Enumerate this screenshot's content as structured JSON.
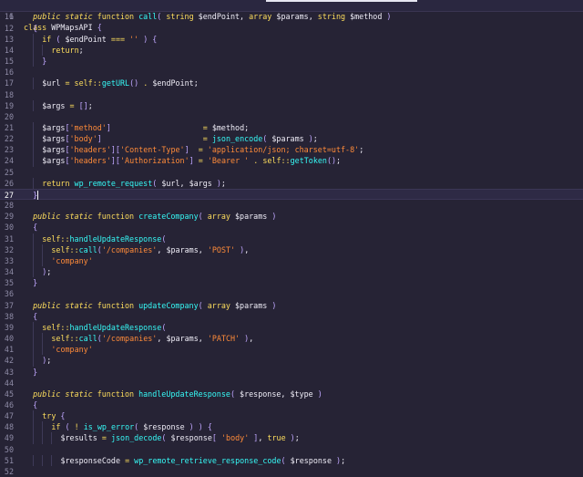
{
  "editor": {
    "sticky_line": {
      "number": "6",
      "tokens": [
        {
          "t": "class ",
          "c": "kw"
        },
        {
          "t": "WPMapsAPI",
          "c": "plain"
        },
        {
          "t": " {",
          "c": "punc"
        }
      ]
    },
    "lines": [
      {
        "n": "11",
        "indent": 2,
        "tokens": [
          {
            "t": "public static ",
            "c": "mod"
          },
          {
            "t": "function ",
            "c": "kw"
          },
          {
            "t": "call",
            "c": "fn"
          },
          {
            "t": "( ",
            "c": "punc"
          },
          {
            "t": "string ",
            "c": "type"
          },
          {
            "t": "$endPoint",
            "c": "var"
          },
          {
            "t": ", ",
            "c": "plain"
          },
          {
            "t": "array ",
            "c": "type"
          },
          {
            "t": "$params",
            "c": "var"
          },
          {
            "t": ", ",
            "c": "plain"
          },
          {
            "t": "string ",
            "c": "type"
          },
          {
            "t": "$method",
            "c": "var"
          },
          {
            "t": " )",
            "c": "punc"
          }
        ]
      },
      {
        "n": "12",
        "indent": 2,
        "tokens": [
          {
            "t": "{",
            "c": "punc"
          }
        ]
      },
      {
        "n": "13",
        "indent": 4,
        "tokens": [
          {
            "t": "if ",
            "c": "kw"
          },
          {
            "t": "( ",
            "c": "punc"
          },
          {
            "t": "$endPoint",
            "c": "var"
          },
          {
            "t": " === ",
            "c": "op"
          },
          {
            "t": "''",
            "c": "str"
          },
          {
            "t": " ) {",
            "c": "punc"
          }
        ]
      },
      {
        "n": "14",
        "indent": 6,
        "tokens": [
          {
            "t": "return",
            "c": "kw"
          },
          {
            "t": ";",
            "c": "plain"
          }
        ]
      },
      {
        "n": "15",
        "indent": 4,
        "tokens": [
          {
            "t": "}",
            "c": "punc"
          }
        ]
      },
      {
        "n": "16",
        "indent": 0,
        "tokens": []
      },
      {
        "n": "17",
        "indent": 4,
        "tokens": [
          {
            "t": "$url",
            "c": "var"
          },
          {
            "t": " = ",
            "c": "op"
          },
          {
            "t": "self",
            "c": "kw"
          },
          {
            "t": "::",
            "c": "op"
          },
          {
            "t": "getURL",
            "c": "fn"
          },
          {
            "t": "()",
            "c": "punc"
          },
          {
            "t": " . ",
            "c": "op"
          },
          {
            "t": "$endPoint",
            "c": "var"
          },
          {
            "t": ";",
            "c": "plain"
          }
        ]
      },
      {
        "n": "18",
        "indent": 0,
        "tokens": []
      },
      {
        "n": "19",
        "indent": 4,
        "tokens": [
          {
            "t": "$args",
            "c": "var"
          },
          {
            "t": " = ",
            "c": "op"
          },
          {
            "t": "[]",
            "c": "punc"
          },
          {
            "t": ";",
            "c": "plain"
          }
        ]
      },
      {
        "n": "20",
        "indent": 0,
        "tokens": []
      },
      {
        "n": "21",
        "indent": 4,
        "tokens": [
          {
            "t": "$args",
            "c": "var"
          },
          {
            "t": "[",
            "c": "punc"
          },
          {
            "t": "'method'",
            "c": "str"
          },
          {
            "t": "]",
            "c": "punc"
          },
          {
            "t": "                    = ",
            "c": "op"
          },
          {
            "t": "$method",
            "c": "var"
          },
          {
            "t": ";",
            "c": "plain"
          }
        ]
      },
      {
        "n": "22",
        "indent": 4,
        "tokens": [
          {
            "t": "$args",
            "c": "var"
          },
          {
            "t": "[",
            "c": "punc"
          },
          {
            "t": "'body'",
            "c": "str"
          },
          {
            "t": "]",
            "c": "punc"
          },
          {
            "t": "                      = ",
            "c": "op"
          },
          {
            "t": "json_encode",
            "c": "fn"
          },
          {
            "t": "( ",
            "c": "punc"
          },
          {
            "t": "$params",
            "c": "var"
          },
          {
            "t": " )",
            "c": "punc"
          },
          {
            "t": ";",
            "c": "plain"
          }
        ]
      },
      {
        "n": "23",
        "indent": 4,
        "tokens": [
          {
            "t": "$args",
            "c": "var"
          },
          {
            "t": "[",
            "c": "punc"
          },
          {
            "t": "'headers'",
            "c": "str"
          },
          {
            "t": "][",
            "c": "punc"
          },
          {
            "t": "'Content-Type'",
            "c": "str"
          },
          {
            "t": "]",
            "c": "punc"
          },
          {
            "t": "  = ",
            "c": "op"
          },
          {
            "t": "'application/json; charset=utf-8'",
            "c": "str"
          },
          {
            "t": ";",
            "c": "plain"
          }
        ]
      },
      {
        "n": "24",
        "indent": 4,
        "tokens": [
          {
            "t": "$args",
            "c": "var"
          },
          {
            "t": "[",
            "c": "punc"
          },
          {
            "t": "'headers'",
            "c": "str"
          },
          {
            "t": "][",
            "c": "punc"
          },
          {
            "t": "'Authorization'",
            "c": "str"
          },
          {
            "t": "]",
            "c": "punc"
          },
          {
            "t": " = ",
            "c": "op"
          },
          {
            "t": "'Bearer '",
            "c": "str"
          },
          {
            "t": " . ",
            "c": "op"
          },
          {
            "t": "self",
            "c": "kw"
          },
          {
            "t": "::",
            "c": "op"
          },
          {
            "t": "getToken",
            "c": "fn"
          },
          {
            "t": "()",
            "c": "punc"
          },
          {
            "t": ";",
            "c": "plain"
          }
        ]
      },
      {
        "n": "25",
        "indent": 0,
        "tokens": []
      },
      {
        "n": "26",
        "indent": 4,
        "tokens": [
          {
            "t": "return ",
            "c": "kw"
          },
          {
            "t": "wp_remote_request",
            "c": "fn"
          },
          {
            "t": "( ",
            "c": "punc"
          },
          {
            "t": "$url",
            "c": "var"
          },
          {
            "t": ", ",
            "c": "plain"
          },
          {
            "t": "$args",
            "c": "var"
          },
          {
            "t": " )",
            "c": "punc"
          },
          {
            "t": ";",
            "c": "plain"
          }
        ]
      },
      {
        "n": "27",
        "indent": 2,
        "current": true,
        "tokens": [
          {
            "t": "}",
            "c": "punc"
          }
        ]
      },
      {
        "n": "28",
        "indent": 0,
        "tokens": []
      },
      {
        "n": "29",
        "indent": 2,
        "tokens": [
          {
            "t": "public static ",
            "c": "mod"
          },
          {
            "t": "function ",
            "c": "kw"
          },
          {
            "t": "createCompany",
            "c": "fn"
          },
          {
            "t": "( ",
            "c": "punc"
          },
          {
            "t": "array ",
            "c": "type"
          },
          {
            "t": "$params",
            "c": "var"
          },
          {
            "t": " )",
            "c": "punc"
          }
        ]
      },
      {
        "n": "30",
        "indent": 2,
        "tokens": [
          {
            "t": "{",
            "c": "punc"
          }
        ]
      },
      {
        "n": "31",
        "indent": 4,
        "tokens": [
          {
            "t": "self",
            "c": "kw"
          },
          {
            "t": "::",
            "c": "op"
          },
          {
            "t": "handleUpdateResponse",
            "c": "fn"
          },
          {
            "t": "(",
            "c": "punc"
          }
        ]
      },
      {
        "n": "32",
        "indent": 6,
        "tokens": [
          {
            "t": "self",
            "c": "kw"
          },
          {
            "t": "::",
            "c": "op"
          },
          {
            "t": "call",
            "c": "fn"
          },
          {
            "t": "(",
            "c": "punc"
          },
          {
            "t": "'/companies'",
            "c": "str"
          },
          {
            "t": ", ",
            "c": "plain"
          },
          {
            "t": "$params",
            "c": "var"
          },
          {
            "t": ", ",
            "c": "plain"
          },
          {
            "t": "'POST'",
            "c": "str"
          },
          {
            "t": " )",
            "c": "punc"
          },
          {
            "t": ",",
            "c": "plain"
          }
        ]
      },
      {
        "n": "33",
        "indent": 6,
        "tokens": [
          {
            "t": "'company'",
            "c": "str"
          }
        ]
      },
      {
        "n": "34",
        "indent": 4,
        "tokens": [
          {
            "t": ")",
            "c": "punc"
          },
          {
            "t": ";",
            "c": "plain"
          }
        ]
      },
      {
        "n": "35",
        "indent": 2,
        "tokens": [
          {
            "t": "}",
            "c": "punc"
          }
        ]
      },
      {
        "n": "36",
        "indent": 0,
        "tokens": []
      },
      {
        "n": "37",
        "indent": 2,
        "tokens": [
          {
            "t": "public static ",
            "c": "mod"
          },
          {
            "t": "function ",
            "c": "kw"
          },
          {
            "t": "updateCompany",
            "c": "fn"
          },
          {
            "t": "( ",
            "c": "punc"
          },
          {
            "t": "array ",
            "c": "type"
          },
          {
            "t": "$params",
            "c": "var"
          },
          {
            "t": " )",
            "c": "punc"
          }
        ]
      },
      {
        "n": "38",
        "indent": 2,
        "tokens": [
          {
            "t": "{",
            "c": "punc"
          }
        ]
      },
      {
        "n": "39",
        "indent": 4,
        "tokens": [
          {
            "t": "self",
            "c": "kw"
          },
          {
            "t": "::",
            "c": "op"
          },
          {
            "t": "handleUpdateResponse",
            "c": "fn"
          },
          {
            "t": "(",
            "c": "punc"
          }
        ]
      },
      {
        "n": "40",
        "indent": 6,
        "tokens": [
          {
            "t": "self",
            "c": "kw"
          },
          {
            "t": "::",
            "c": "op"
          },
          {
            "t": "call",
            "c": "fn"
          },
          {
            "t": "(",
            "c": "punc"
          },
          {
            "t": "'/companies'",
            "c": "str"
          },
          {
            "t": ", ",
            "c": "plain"
          },
          {
            "t": "$params",
            "c": "var"
          },
          {
            "t": ", ",
            "c": "plain"
          },
          {
            "t": "'PATCH'",
            "c": "str"
          },
          {
            "t": " )",
            "c": "punc"
          },
          {
            "t": ",",
            "c": "plain"
          }
        ]
      },
      {
        "n": "41",
        "indent": 6,
        "tokens": [
          {
            "t": "'company'",
            "c": "str"
          }
        ]
      },
      {
        "n": "42",
        "indent": 4,
        "tokens": [
          {
            "t": ")",
            "c": "punc"
          },
          {
            "t": ";",
            "c": "plain"
          }
        ]
      },
      {
        "n": "43",
        "indent": 2,
        "tokens": [
          {
            "t": "}",
            "c": "punc"
          }
        ]
      },
      {
        "n": "44",
        "indent": 0,
        "tokens": []
      },
      {
        "n": "45",
        "indent": 2,
        "tokens": [
          {
            "t": "public static ",
            "c": "mod"
          },
          {
            "t": "function ",
            "c": "kw"
          },
          {
            "t": "handleUpdateResponse",
            "c": "fn"
          },
          {
            "t": "( ",
            "c": "punc"
          },
          {
            "t": "$response",
            "c": "var"
          },
          {
            "t": ", ",
            "c": "plain"
          },
          {
            "t": "$type",
            "c": "var"
          },
          {
            "t": " )",
            "c": "punc"
          }
        ]
      },
      {
        "n": "46",
        "indent": 2,
        "tokens": [
          {
            "t": "{",
            "c": "punc"
          }
        ]
      },
      {
        "n": "47",
        "indent": 4,
        "tokens": [
          {
            "t": "try ",
            "c": "kw"
          },
          {
            "t": "{",
            "c": "punc"
          }
        ]
      },
      {
        "n": "48",
        "indent": 6,
        "tokens": [
          {
            "t": "if ",
            "c": "kw"
          },
          {
            "t": "( ",
            "c": "punc"
          },
          {
            "t": "! ",
            "c": "op"
          },
          {
            "t": "is_wp_error",
            "c": "fn"
          },
          {
            "t": "( ",
            "c": "punc"
          },
          {
            "t": "$response",
            "c": "var"
          },
          {
            "t": " ) ) {",
            "c": "punc"
          }
        ]
      },
      {
        "n": "49",
        "indent": 8,
        "tokens": [
          {
            "t": "$results",
            "c": "var"
          },
          {
            "t": " = ",
            "c": "op"
          },
          {
            "t": "json_decode",
            "c": "fn"
          },
          {
            "t": "( ",
            "c": "punc"
          },
          {
            "t": "$response",
            "c": "var"
          },
          {
            "t": "[ ",
            "c": "punc"
          },
          {
            "t": "'body'",
            "c": "str"
          },
          {
            "t": " ]",
            "c": "punc"
          },
          {
            "t": ", ",
            "c": "plain"
          },
          {
            "t": "true",
            "c": "kw"
          },
          {
            "t": " )",
            "c": "punc"
          },
          {
            "t": ";",
            "c": "plain"
          }
        ]
      },
      {
        "n": "50",
        "indent": 0,
        "tokens": []
      },
      {
        "n": "51",
        "indent": 8,
        "tokens": [
          {
            "t": "$responseCode",
            "c": "var"
          },
          {
            "t": " = ",
            "c": "op"
          },
          {
            "t": "wp_remote_retrieve_response_code",
            "c": "fn"
          },
          {
            "t": "( ",
            "c": "punc"
          },
          {
            "t": "$response",
            "c": "var"
          },
          {
            "t": " )",
            "c": "punc"
          },
          {
            "t": ";",
            "c": "plain"
          }
        ]
      },
      {
        "n": "52",
        "indent": 0,
        "tokens": []
      }
    ]
  }
}
